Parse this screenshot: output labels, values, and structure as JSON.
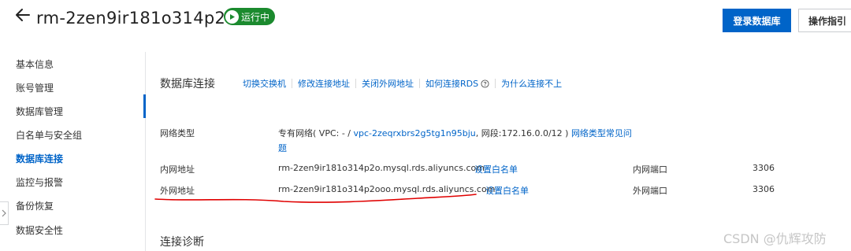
{
  "header": {
    "instance_id": "rm-2zen9ir181o314p2o",
    "status": "运行中",
    "login_button": "登录数据库",
    "guide_button": "操作指引"
  },
  "sidebar": {
    "items": [
      {
        "label": "基本信息"
      },
      {
        "label": "账号管理"
      },
      {
        "label": "数据库管理"
      },
      {
        "label": "白名单与安全组"
      },
      {
        "label": "数据库连接"
      },
      {
        "label": "监控与报警"
      },
      {
        "label": "备份恢复"
      },
      {
        "label": "数据安全性"
      }
    ],
    "active": "数据库连接"
  },
  "connection": {
    "title": "数据库连接",
    "links": [
      {
        "label": "切换交换机"
      },
      {
        "label": "修改连接地址"
      },
      {
        "label": "关闭外网地址"
      },
      {
        "label": "如何连接RDS"
      },
      {
        "label": "为什么连接不上"
      }
    ],
    "network_type": {
      "label": "网络类型",
      "prefix": "专有网络( VPC: - / ",
      "vpc_id": "vpc-2zeqrxbrs2g5tg1n95bju",
      "segment": ", 网段:172.16.0.0/12 ) ",
      "faq_link": "网络类型常见问",
      "faq_link_cont": "题"
    },
    "intranet": {
      "label": "内网地址",
      "address": "rm-2zen9ir181o314p2o.mysql.rds.aliyuncs.com",
      "whitelist_link": "设置白名单",
      "port_label": "内网端口",
      "port": "3306"
    },
    "public": {
      "label": "外网地址",
      "address": "rm-2zen9ir181o314p2ooo.mysql.rds.aliyuncs.com",
      "whitelist_link": "设置白名单",
      "port_label": "外网端口",
      "port": "3306"
    }
  },
  "diagnosis": {
    "title": "连接诊断"
  },
  "watermark": "CSDN @仇辉攻防",
  "colors": {
    "primary": "#0064c8",
    "status_green": "#1b8a2e",
    "annotation_red": "#e00000"
  }
}
